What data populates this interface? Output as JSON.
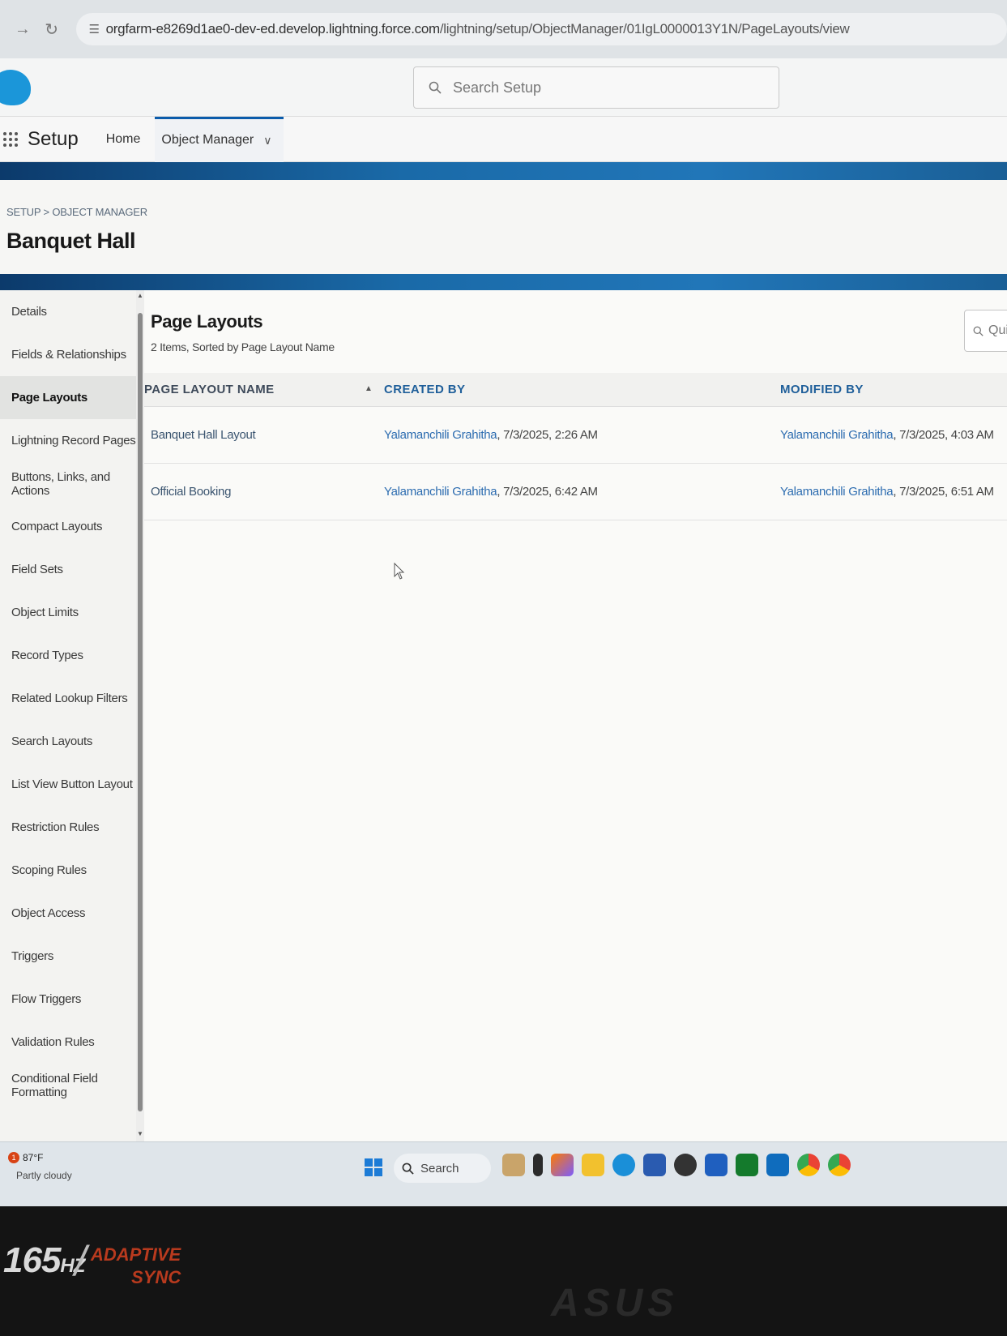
{
  "browser": {
    "url_prefix": "orgfarm-e8269d1ae0-dev-ed.develop.lightning.force.com",
    "url_path": "/lightning/setup/ObjectManager/01IgL0000013Y1N/PageLayouts/view"
  },
  "header": {
    "search_placeholder": "Search Setup"
  },
  "setup_nav": {
    "title": "Setup",
    "tabs": [
      {
        "label": "Home"
      },
      {
        "label": "Object Manager"
      }
    ]
  },
  "object": {
    "breadcrumb": "SETUP > OBJECT MANAGER",
    "title": "Banquet Hall"
  },
  "sidebar": {
    "items": [
      {
        "label": "Details"
      },
      {
        "label": "Fields & Relationships"
      },
      {
        "label": "Page Layouts"
      },
      {
        "label": "Lightning Record Pages"
      },
      {
        "label": "Buttons, Links, and Actions"
      },
      {
        "label": "Compact Layouts"
      },
      {
        "label": "Field Sets"
      },
      {
        "label": "Object Limits"
      },
      {
        "label": "Record Types"
      },
      {
        "label": "Related Lookup Filters"
      },
      {
        "label": "Search Layouts"
      },
      {
        "label": "List View Button Layout"
      },
      {
        "label": "Restriction Rules"
      },
      {
        "label": "Scoping Rules"
      },
      {
        "label": "Object Access"
      },
      {
        "label": "Triggers"
      },
      {
        "label": "Flow Triggers"
      },
      {
        "label": "Validation Rules"
      },
      {
        "label": "Conditional Field Formatting"
      }
    ],
    "active_index": 2
  },
  "list": {
    "title": "Page Layouts",
    "subtitle": "2 Items, Sorted by Page Layout Name",
    "quick_find_placeholder": "Quic",
    "columns": {
      "name": "PAGE LAYOUT NAME",
      "created": "CREATED BY",
      "modified": "MODIFIED BY"
    },
    "rows": [
      {
        "name": "Banquet Hall Layout",
        "created_user": "Yalamanchili Grahitha",
        "created_stamp": ", 7/3/2025, 2:26 AM",
        "modified_user": "Yalamanchili Grahitha",
        "modified_stamp": ", 7/3/2025, 4:03 AM"
      },
      {
        "name": "Official Booking",
        "created_user": "Yalamanchili Grahitha",
        "created_stamp": ", 7/3/2025, 6:42 AM",
        "modified_user": "Yalamanchili Grahitha",
        "modified_stamp": ", 7/3/2025, 6:51 AM"
      }
    ]
  },
  "taskbar": {
    "weather_badge": "1",
    "weather_temp": "87°F",
    "weather_desc": "Partly cloudy",
    "search_label": "Search"
  },
  "monitor": {
    "hz": "165",
    "hz_unit": "HZ",
    "adaptive_line1": "ADAPTIVE",
    "adaptive_line2": "SYNC",
    "brand": "ASUS"
  },
  "colors": {
    "accent": "#0b5cab",
    "link": "#2c6cb0",
    "banner": "#1a6aa8"
  }
}
